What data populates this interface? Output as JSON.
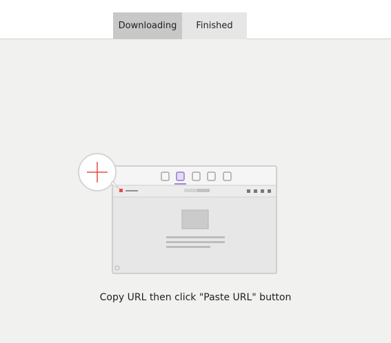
{
  "tabs": {
    "downloading": "Downloading",
    "finished": "Finished",
    "active": "downloading"
  },
  "empty_state": {
    "message": "Copy URL then click \"Paste URL\" button"
  },
  "icons": {
    "add": "plus-icon",
    "browser": "browser-window-icon"
  },
  "colors": {
    "accent_purple": "#9f86d6",
    "accent_red": "#e84a3f",
    "tab_active": "#c8c8c8",
    "tab_inactive": "#e6e6e6",
    "page_bg": "#f1f1f0"
  }
}
